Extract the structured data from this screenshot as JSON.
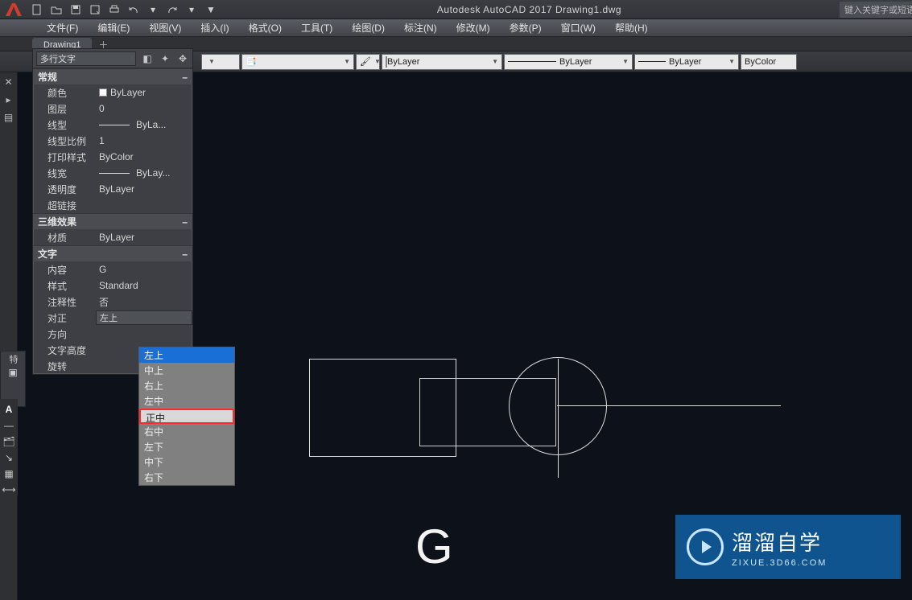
{
  "app": {
    "title": "Autodesk AutoCAD 2017    Drawing1.dwg",
    "searchPlaceholder": "键入关键字或短语"
  },
  "menus": [
    "文件(F)",
    "编辑(E)",
    "视图(V)",
    "插入(I)",
    "格式(O)",
    "工具(T)",
    "绘图(D)",
    "标注(N)",
    "修改(M)",
    "参数(P)",
    "窗口(W)",
    "帮助(H)"
  ],
  "tab": {
    "name": "Drawing1"
  },
  "ribbon": {
    "layer": "ByLayer",
    "linetype": "ByLayer",
    "lineweight": "ByLayer",
    "plotstyle": "ByColor"
  },
  "properties": {
    "selector": "多行文字",
    "sections": {
      "general": {
        "title": "常规",
        "color": {
          "label": "颜色",
          "value": "ByLayer"
        },
        "layer": {
          "label": "图层",
          "value": "0"
        },
        "linetype": {
          "label": "线型",
          "value": "ByLa..."
        },
        "ltscale": {
          "label": "线型比例",
          "value": "1"
        },
        "plotstyle": {
          "label": "打印样式",
          "value": "ByColor"
        },
        "lineweight": {
          "label": "线宽",
          "value": "ByLay..."
        },
        "transparency": {
          "label": "透明度",
          "value": "ByLayer"
        },
        "hyperlink": {
          "label": "超链接",
          "value": ""
        }
      },
      "threeD": {
        "title": "三维效果",
        "material": {
          "label": "材质",
          "value": "ByLayer"
        }
      },
      "text": {
        "title": "文字",
        "contents": {
          "label": "内容",
          "value": "G"
        },
        "style": {
          "label": "样式",
          "value": "Standard"
        },
        "annotative": {
          "label": "注释性",
          "value": "否"
        },
        "justify": {
          "label": "对正",
          "value": "左上"
        },
        "direction": {
          "label": "方向",
          "value": ""
        },
        "height": {
          "label": "文字高度",
          "value": ""
        },
        "rotation": {
          "label": "旋转",
          "value": ""
        }
      }
    },
    "justifyOptions": [
      "左上",
      "中上",
      "右上",
      "左中",
      "正中",
      "右中",
      "左下",
      "中下",
      "右下"
    ],
    "highlighted": "正中",
    "selected": "左上"
  },
  "canvas": {
    "textObject": "G"
  },
  "watermark": {
    "cn": "溜溜自学",
    "en": "ZIXUE.3D66.COM"
  }
}
